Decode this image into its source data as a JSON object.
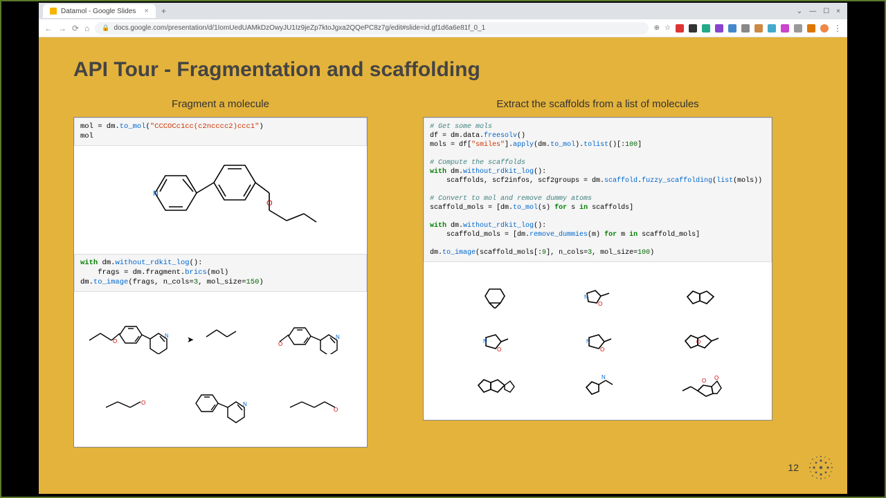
{
  "browser": {
    "tab_title": "Datamol - Google Slides",
    "url": "docs.google.com/presentation/d/1IomUedUAMkDzOwyJU1Iz9jeZp7ktoJgxa2QQePC8z7g/edit#slide=id.gf1d6a6e81f_0_1"
  },
  "slide": {
    "title": "API Tour - Fragmentation and scaffolding",
    "page_number": "12",
    "left": {
      "heading": "Fragment a molecule",
      "code1_plain": "mol = dm.to_mol(\"CCCOCc1cc(c2ncccc2)ccc1\")\nmol",
      "code2_plain": "with dm.without_rdkit_log():\n    frags = dm.fragment.brics(mol)\ndm.to_image(frags, n_cols=3, mol_size=150)"
    },
    "right": {
      "heading": "Extract the scaffolds from a list of molecules",
      "code_plain": "# Get some mols\ndf = dm.data.freesolv()\nmols = df[\"smiles\"].apply(dm.to_mol).tolist()[:100]\n\n# Compute the scaffolds\nwith dm.without_rdkit_log():\n    scaffolds, scf2infos, scf2groups = dm.scaffold.fuzzy_scaffolding(list(mols))\n\n# Convert to mol and remove dummy atoms\nscaffold_mols = [dm.to_mol(s) for s in scaffolds]\n\nwith dm.without_rdkit_log():\n    scaffold_mols = [dm.remove_dummies(m) for m in scaffold_mols]\n\ndm.to_image(scaffold_mols[:9], n_cols=3, mol_size=100)"
    }
  }
}
